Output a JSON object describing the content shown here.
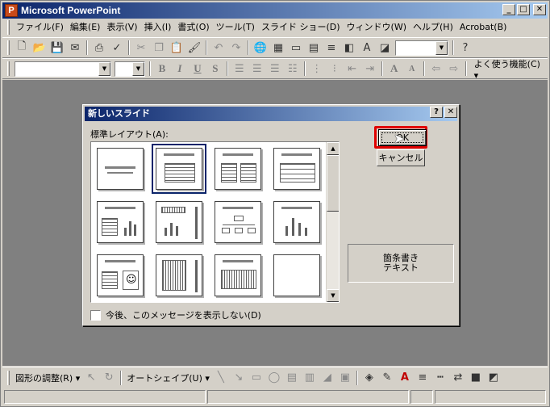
{
  "window": {
    "title": "Microsoft PowerPoint",
    "icon_letter": "P"
  },
  "menu": [
    "ファイル(F)",
    "編集(E)",
    "表示(V)",
    "挿入(I)",
    "書式(O)",
    "ツール(T)",
    "スライド ショー(D)",
    "ウィンドウ(W)",
    "ヘルプ(H)",
    "Acrobat(B)"
  ],
  "toolbar2": {
    "common_tasks": "よく使う機能(C) ▾"
  },
  "drawing_toolbar": {
    "draw": "図形の調整(R) ▾",
    "autoshapes": "オートシェイプ(U) ▾"
  },
  "dialog": {
    "title": "新しいスライド",
    "layout_label": "標準レイアウト(A):",
    "ok": "OK",
    "cancel": "キャンセル",
    "preview_line1": "箇条書き",
    "preview_line2": "テキスト",
    "dont_show": "今後、このメッセージを表示しない(D)",
    "selected_layout": "箇条書きテキスト"
  }
}
